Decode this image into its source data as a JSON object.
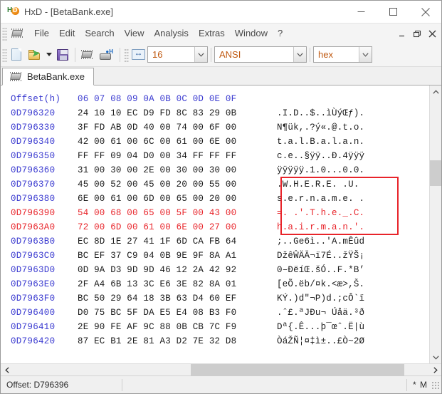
{
  "window": {
    "title": "HxD - [BetaBank.exe]",
    "icon": "hxd-app-icon",
    "minimize": "—",
    "maximize": "□",
    "close": "✕"
  },
  "menubar": {
    "icon": "chip-icon",
    "items": [
      {
        "label": "File"
      },
      {
        "label": "Edit"
      },
      {
        "label": "Search"
      },
      {
        "label": "View"
      },
      {
        "label": "Analysis"
      },
      {
        "label": "Extras"
      },
      {
        "label": "Window"
      },
      {
        "label": "?"
      }
    ],
    "mdi": {
      "minimize": "minimize-document-icon",
      "restore": "restore-document-icon",
      "close": "close-document-icon"
    }
  },
  "toolbar": {
    "new_icon": "new-document-icon",
    "open_icon": "open-file-icon",
    "open_dropdown_icon": "chevron-down-icon",
    "save_icon": "save-icon",
    "chip_icon": "open-disk-icon",
    "diskchip_icon": "open-ram-icon",
    "width_icon": "bytes-per-row-icon",
    "bytes_per_row": "16",
    "encoding": "ANSI",
    "number_base": "hex",
    "dropdown_icon": "chevron-down-icon"
  },
  "tabs": [
    {
      "label": "BetaBank.exe",
      "icon": "document-chip-icon",
      "active": true
    }
  ],
  "hex_view": {
    "header": {
      "offset_label": "Offset(h)",
      "columns": "06 07 08 09 0A 0B 0C 0D 0E 0F"
    },
    "rows": [
      {
        "offset": "0D796320",
        "hex": "24 10 10 EC D9 FD 8C 83 29 0B",
        "ascii": ".I.D..$..ìÙýŒƒ).",
        "selected": false
      },
      {
        "offset": "0D796330",
        "hex": "3F FD AB 0D 40 00 74 00 6F 00",
        "ascii": "N¶ük,.?ý«.@.t.o.",
        "selected": false
      },
      {
        "offset": "0D796340",
        "hex": "42 00 61 00 6C 00 61 00 6E 00",
        "ascii": "t.a.l.B.a.l.a.n.",
        "selected": false
      },
      {
        "offset": "0D796350",
        "hex": "FF FF 09 04 D0 00 34 FF FF FF",
        "ascii": "c.e..§ÿÿ..Ð.4ÿÿÿ",
        "selected": false
      },
      {
        "offset": "0D796360",
        "hex": "31 00 30 00 2E 00 30 00 30 00",
        "ascii": "ÿÿÿÿÿ.1.0...0.0.",
        "selected": false
      },
      {
        "offset": "0D796370",
        "hex": "45 00 52 00 45 00 20 00 55 00",
        "ascii": ".W.H.E.R.E. .U.",
        "selected": false
      },
      {
        "offset": "0D796380",
        "hex": "6E 00 61 00 6D 00 65 00 20 00",
        "ascii": "s.e.r.n.a.m.e. .",
        "selected": false
      },
      {
        "offset": "0D796390",
        "hex": "54 00 68 00 65 00 5F 00 43 00",
        "ascii": "=. .'.T.h.e._.C.",
        "selected": true
      },
      {
        "offset": "0D7963A0",
        "hex": "72 00 6D 00 61 00 6E 00 27 00",
        "ascii": "h.a.i.r.m.a.n.'.",
        "selected": true
      },
      {
        "offset": "0D7963B0",
        "hex": "EC 8D 1E 27 41 1F 6D CA FB 64",
        "ascii": ";..Ge6ì..'A.mÊûd",
        "selected": false
      },
      {
        "offset": "0D7963C0",
        "hex": "BC EF 37 C9 04 0B 9E 9F 8A A1",
        "ascii": "DžêŴÄÄ¬ï7É..žŸŠ¡",
        "selected": false
      },
      {
        "offset": "0D7963D0",
        "hex": "0D 9A D3 9D 9D 46 12 2A 42 92",
        "ascii": "0–ÐëíŒ.šÓ..F.*B’",
        "selected": false
      },
      {
        "offset": "0D7963E0",
        "hex": "2F A4 6B 13 3C E6 3E 82 8A 01",
        "ascii": "[eÕ.ëb/¤k.<æ>,Š.",
        "selected": false
      },
      {
        "offset": "0D7963F0",
        "hex": "BC 50 29 64 18 3B 63 D4 60 EF",
        "ascii": "KÝ.)d\"¬P)d.;cÔ`ï",
        "selected": false
      },
      {
        "offset": "0D796400",
        "hex": "D0 75 BC 5F DA E5 E4 08 B3 F0",
        "ascii": ".ˆ£.ªJÐu¬ Úåä.³ð",
        "selected": false
      },
      {
        "offset": "0D796410",
        "hex": "2E 90 FE AF 9C 88 0B CB 7C F9",
        "ascii": "Dª{.Ê...þ‾œˆ.Ë|ù",
        "selected": false
      },
      {
        "offset": "0D796420",
        "hex": "87 EC B1 2E 81 A3 D2 7E 32 D8",
        "ascii": "ÒáŽÑ¦¤‡ì±..£Ò~2Ø",
        "selected": false
      }
    ],
    "highlight": {
      "color": "#e8242a",
      "text": "WHERE Username = 'The_Chairman'"
    },
    "scroll": {
      "vertical_up_icon": "chevron-up-icon",
      "vertical_down_icon": "chevron-down-icon",
      "horizontal_left_icon": "chevron-left-icon",
      "horizontal_right_icon": "chevron-right-icon"
    }
  },
  "statusbar": {
    "offset": "Offset: D796396",
    "middle": "",
    "right": "* M"
  }
}
